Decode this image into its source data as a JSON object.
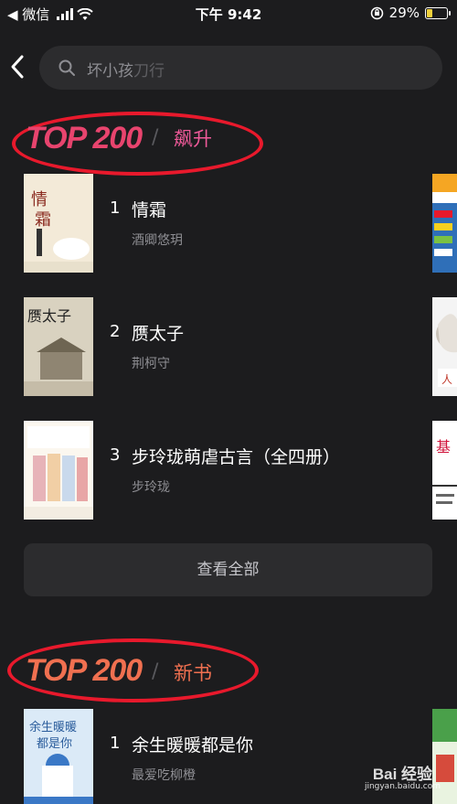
{
  "status_bar": {
    "carrier": "◀ 微信",
    "time": "下午 9:42",
    "battery_percent": "29%",
    "battery_level": 0.29
  },
  "search": {
    "placeholder_main": "坏小孩",
    "placeholder_suffix": "刀行"
  },
  "sections": [
    {
      "logo_text": "TOP 200",
      "name": "飙升",
      "books": [
        {
          "rank": "1",
          "title": "情霜",
          "author": "酒卿悠玥"
        },
        {
          "rank": "2",
          "title": "赝太子",
          "author": "荆柯守"
        },
        {
          "rank": "3",
          "title": "步玲珑萌虐古言（全四册）",
          "author": "步玲珑"
        }
      ],
      "view_all": "查看全部"
    },
    {
      "logo_text": "TOP 200",
      "name": "新书",
      "books": [
        {
          "rank": "1",
          "title": "余生暖暖都是你",
          "author": "最爱吃柳橙"
        }
      ]
    }
  ],
  "watermark": {
    "logo": "Bai 经验",
    "sub": "jingyan.baidu.com"
  },
  "colors": {
    "background": "#1c1c1e",
    "logo_gradient_start": "#e8192c",
    "logo_gradient_end": "#f06ec2",
    "oval": "#e8192c",
    "section2_name": "#f07050"
  }
}
